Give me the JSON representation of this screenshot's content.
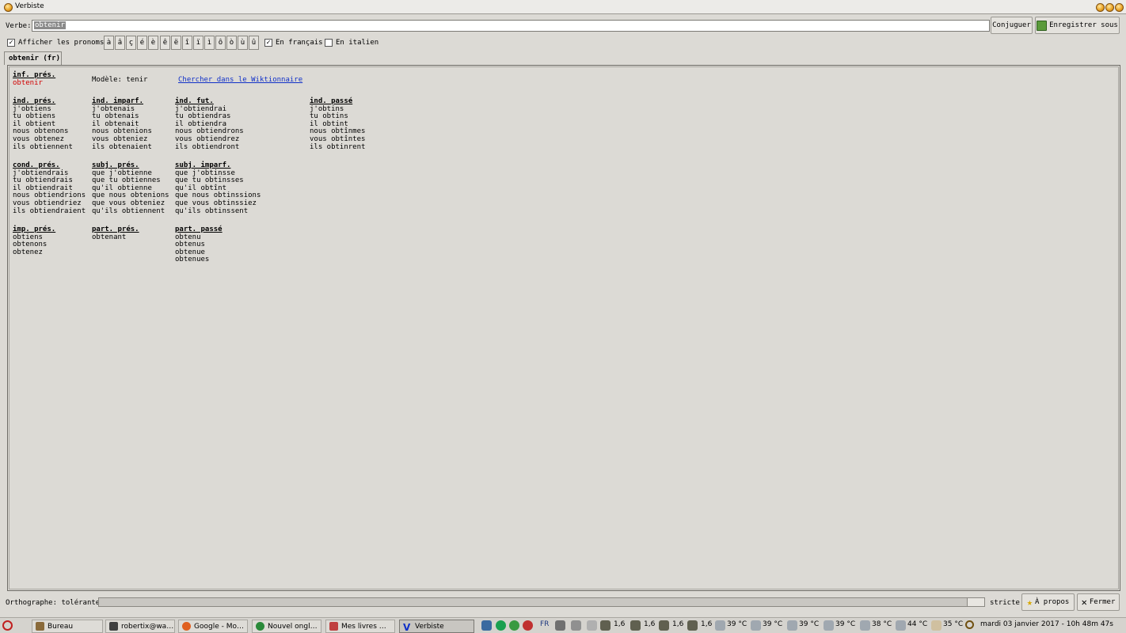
{
  "window": {
    "title": "Verbiste"
  },
  "toolbar": {
    "verb_label": "Verbe:",
    "verb_value": "obtenir",
    "conjugate_label": "Conjuguer",
    "save_label": "Enregistrer sous"
  },
  "options": {
    "show_pronouns_label": "Afficher les pronoms",
    "show_pronouns_checked": true,
    "accents": [
      "à",
      "â",
      "ç",
      "é",
      "è",
      "ê",
      "ë",
      "î",
      "ï",
      "ì",
      "ô",
      "ò",
      "ù",
      "û"
    ],
    "french_label": "En français",
    "french_checked": true,
    "italian_label": "En italien",
    "italian_checked": false
  },
  "tab": {
    "label": "obtenir (fr)"
  },
  "conjugation": {
    "infinitive": {
      "header": "inf. prés.",
      "value": "obtenir"
    },
    "model_label": "Modèle: tenir",
    "wiktionary_link": "Chercher dans le Wiktionnaire",
    "ind_pres": {
      "header": "ind. prés.",
      "forms": [
        "j'obtiens",
        "tu obtiens",
        "il obtient",
        "nous obtenons",
        "vous obtenez",
        "ils obtiennent"
      ]
    },
    "ind_imparf": {
      "header": "ind. imparf.",
      "forms": [
        "j'obtenais",
        "tu obtenais",
        "il obtenait",
        "nous obtenions",
        "vous obteniez",
        "ils obtenaient"
      ]
    },
    "ind_fut": {
      "header": "ind. fut.",
      "forms": [
        "j'obtiendrai",
        "tu obtiendras",
        "il obtiendra",
        "nous obtiendrons",
        "vous obtiendrez",
        "ils obtiendront"
      ]
    },
    "ind_passe": {
      "header": "ind. passé",
      "forms": [
        "j'obtins",
        "tu obtins",
        "il obtint",
        "nous obtînmes",
        "vous obtîntes",
        "ils obtinrent"
      ]
    },
    "cond_pres": {
      "header": "cond. prés.",
      "forms": [
        "j'obtiendrais",
        "tu obtiendrais",
        "il obtiendrait",
        "nous obtiendrions",
        "vous obtiendriez",
        "ils obtiendraient"
      ]
    },
    "subj_pres": {
      "header": "subj. prés.",
      "forms": [
        "que j'obtienne",
        "que tu obtiennes",
        "qu'il obtienne",
        "que nous obtenions",
        "que vous obteniez",
        "qu'ils obtiennent"
      ]
    },
    "subj_imparf": {
      "header": "subj. imparf.",
      "forms": [
        "que j'obtinsse",
        "que tu obtinsses",
        "qu'il obtînt",
        "que nous obtinssions",
        "que vous obtinssiez",
        "qu'ils obtinssent"
      ]
    },
    "imp_pres": {
      "header": "imp. prés.",
      "forms": [
        "obtiens",
        "obtenons",
        "obtenez"
      ]
    },
    "part_pres": {
      "header": "part. prés.",
      "forms": [
        "obtenant"
      ]
    },
    "part_passe": {
      "header": "part. passé",
      "forms": [
        "obtenu",
        "obtenus",
        "obtenue",
        "obtenues"
      ]
    }
  },
  "statusbar": {
    "spelling_label": "Orthographe: tolérante",
    "strict_label": "stricte",
    "about_label": "À propos",
    "close_label": "Fermer"
  },
  "taskbar": {
    "tasks": [
      "Bureau",
      "robertix@wa…",
      "Google - Mo…",
      "Nouvel ongl…",
      "Mes livres …",
      "Verbiste"
    ],
    "keyboard": "FR",
    "cpu": [
      "1,6",
      "1,6",
      "1,6",
      "1,6"
    ],
    "temps": [
      "39 °C",
      "39 °C",
      "39 °C",
      "39 °C",
      "38 °C",
      "44 °C",
      "35 °C"
    ],
    "clock": "mardi 03 janvier 2017 - 10h 48m 47s"
  },
  "colors": {
    "infinitive": "#d10000",
    "link": "#1030c8",
    "background": "#dcdad5"
  }
}
